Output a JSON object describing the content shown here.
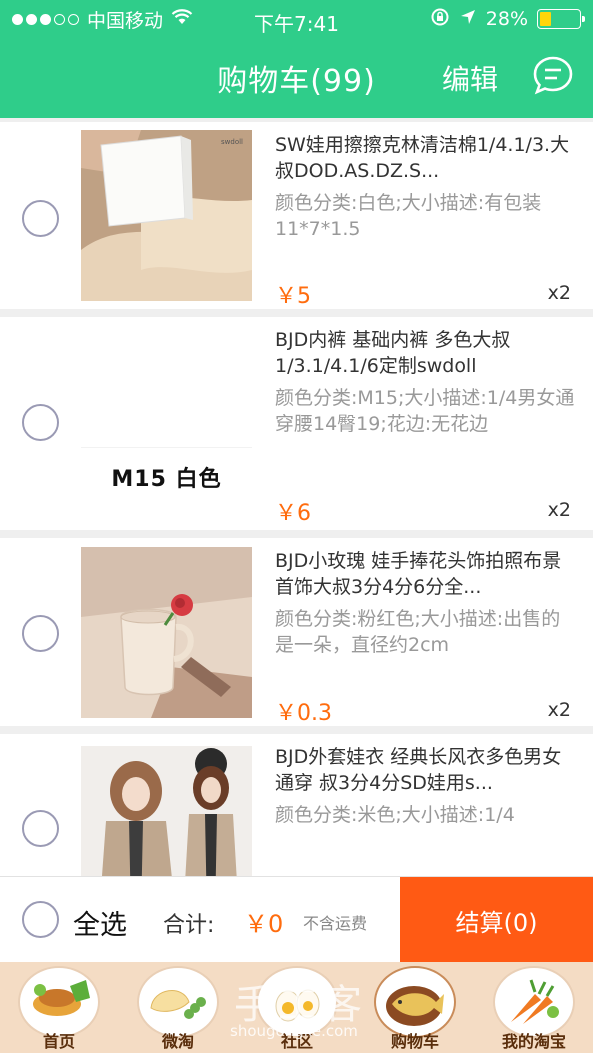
{
  "status_bar": {
    "carrier": "中国移动",
    "time": "下午7:41",
    "battery": "28%",
    "battery_level": 0.28
  },
  "header": {
    "title": "购物车(99)",
    "edit_label": "编辑",
    "chat_icon": "message-bubble-icon"
  },
  "colors": {
    "header_bg": "#2fcd8a",
    "price": "#ff6c0e",
    "settle_bg": "#ff5a14"
  },
  "items": [
    {
      "title": "SW娃用擦擦克林清洁棉1/4.1/3.大叔DOD.AS.DZ.S...",
      "attrs": "颜色分类:白色;大小描述:有包装11*7*1.5",
      "price": "￥5",
      "qty": "x2"
    },
    {
      "title": "BJD内裤 基础内裤 多色大叔1/3.1/4.1/6定制swdoll",
      "attrs": "颜色分类:M15;大小描述:1/4男女通穿腰14臀19;花边:无花边",
      "price": "￥6",
      "qty": "x2",
      "thumb_text": "M15 白色"
    },
    {
      "title": "BJD小玫瑰 娃手捧花头饰拍照布景首饰大叔3分4分6分全...",
      "attrs": "颜色分类:粉红色;大小描述:出售的是一朵，直径约2cm",
      "price": "￥0.3",
      "qty": "x2"
    },
    {
      "title": "BJD外套娃衣 经典长风衣多色男女通穿 叔3分4分SD娃用s...",
      "attrs": "颜色分类:米色;大小描述:1/4",
      "price": "",
      "qty": ""
    }
  ],
  "checkout": {
    "select_all": "全选",
    "total_label": "合计:",
    "total_value": "￥0",
    "shipping_note": "不含运费",
    "settle_label": "结算(0)"
  },
  "tabs": [
    {
      "label": "首页",
      "icon": "home-food-icon"
    },
    {
      "label": "微淘",
      "icon": "dumpling-icon"
    },
    {
      "label": "社区",
      "icon": "egg-community-icon"
    },
    {
      "label": "购物车",
      "icon": "fish-cart-icon"
    },
    {
      "label": "我的淘宝",
      "icon": "carrot-profile-icon"
    }
  ],
  "watermark": {
    "main": "手工客",
    "sub": "shougongke.com"
  }
}
